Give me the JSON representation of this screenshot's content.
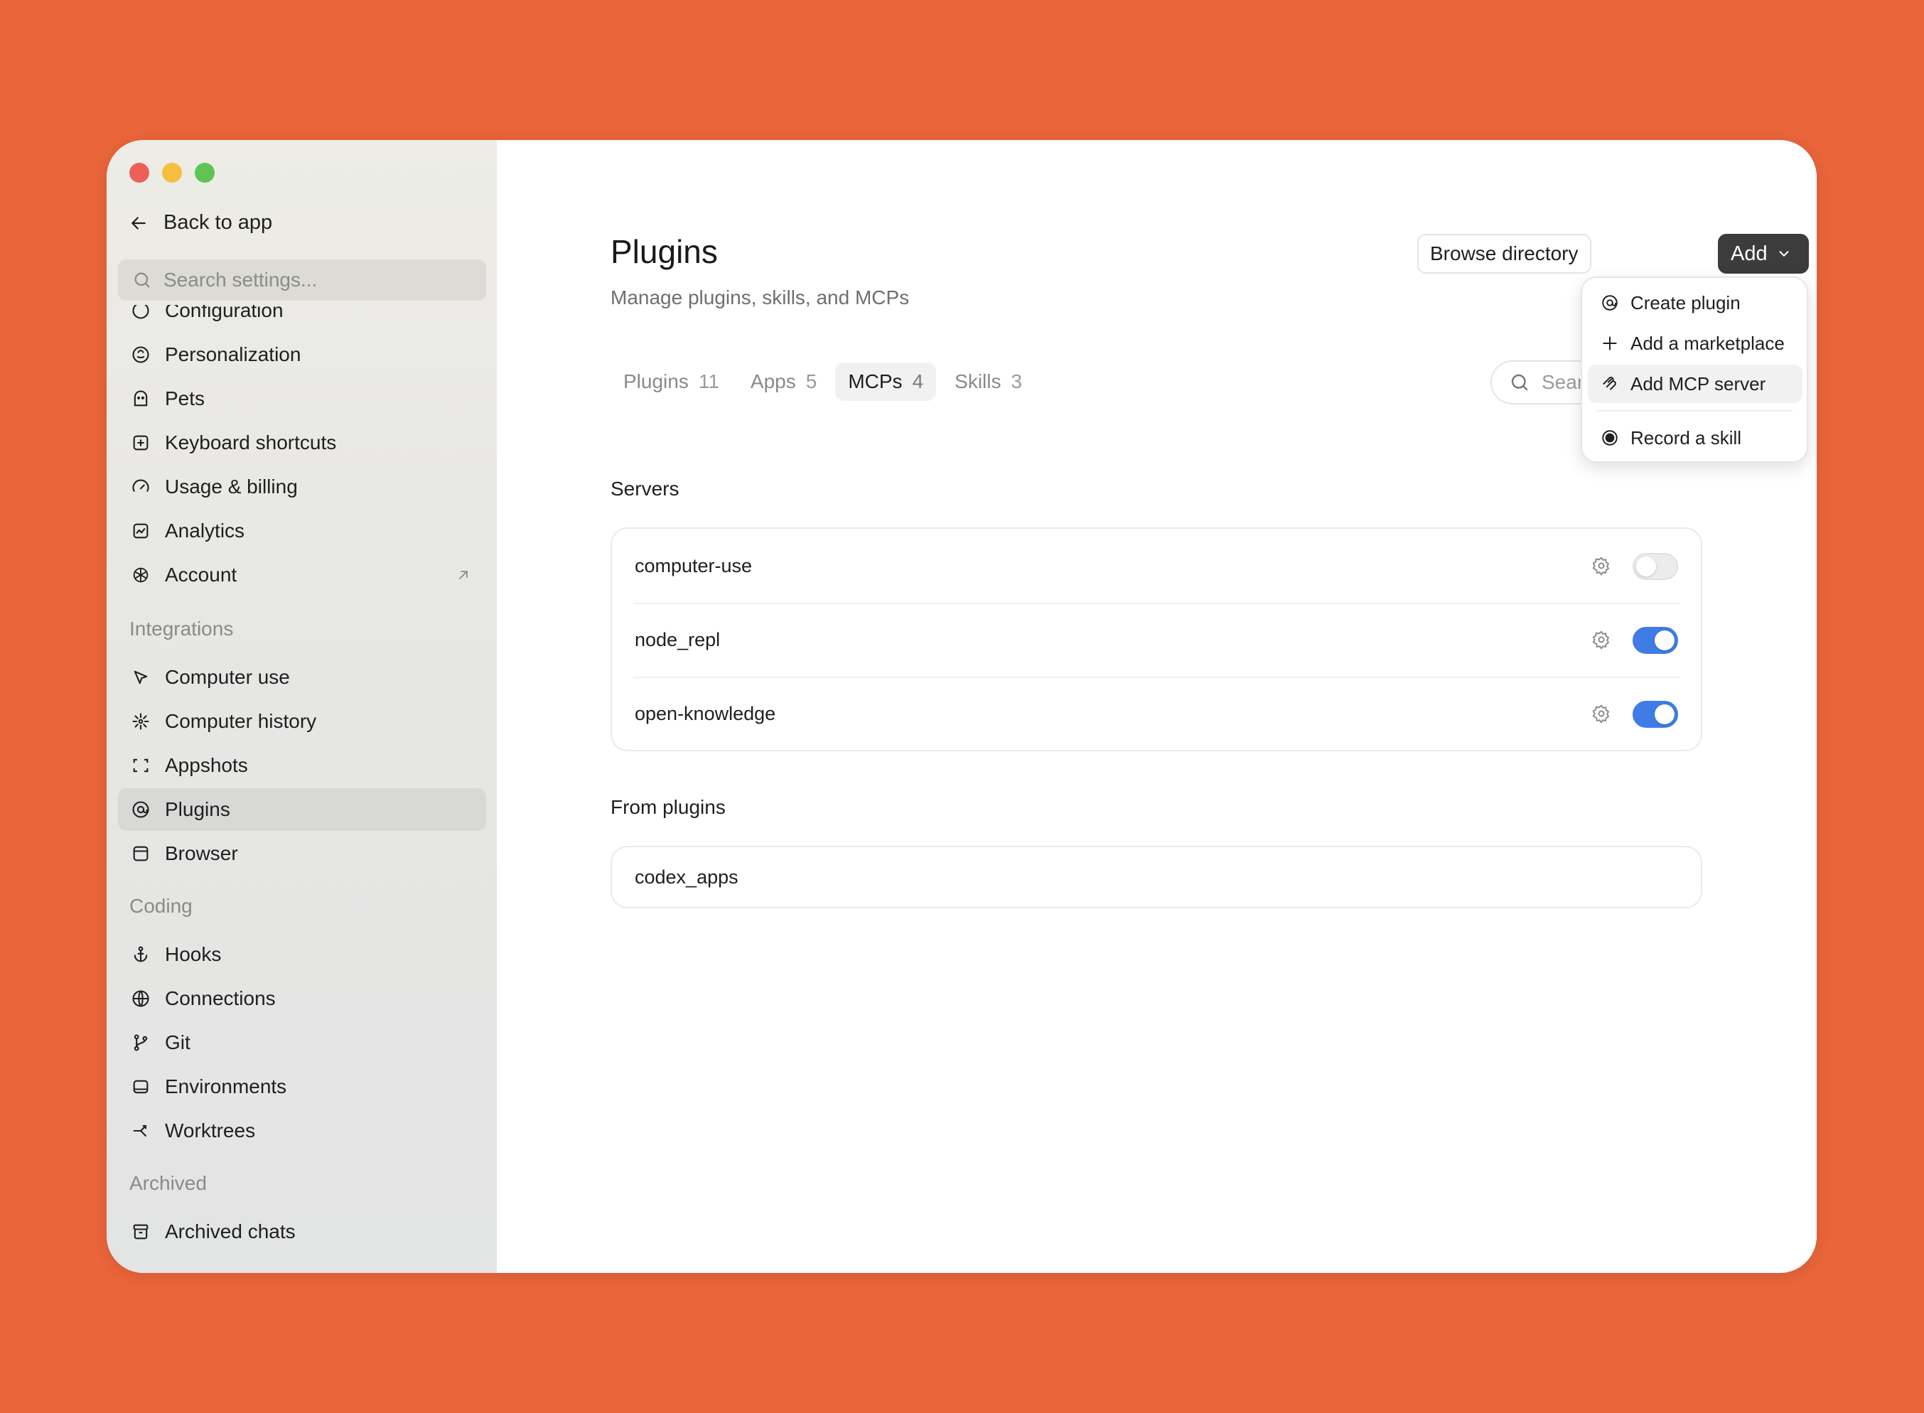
{
  "sidebar": {
    "back_label": "Back to app",
    "search_placeholder": "Search settings...",
    "partial_item": "Configuration",
    "items_top": [
      {
        "label": "Personalization",
        "icon": "palette-icon"
      },
      {
        "label": "Pets",
        "icon": "pet-icon"
      },
      {
        "label": "Keyboard shortcuts",
        "icon": "keyboard-icon"
      },
      {
        "label": "Usage & billing",
        "icon": "gauge-icon"
      },
      {
        "label": "Analytics",
        "icon": "chart-icon"
      },
      {
        "label": "Account",
        "icon": "openai-icon"
      }
    ],
    "section_integrations": "Integrations",
    "items_integrations": [
      {
        "label": "Computer use",
        "icon": "cursor-icon"
      },
      {
        "label": "Computer history",
        "icon": "history-icon"
      },
      {
        "label": "Appshots",
        "icon": "screenshot-icon"
      },
      {
        "label": "Plugins",
        "icon": "at-icon"
      },
      {
        "label": "Browser",
        "icon": "browser-icon"
      }
    ],
    "section_coding": "Coding",
    "items_coding": [
      {
        "label": "Hooks",
        "icon": "anchor-icon"
      },
      {
        "label": "Connections",
        "icon": "globe-icon"
      },
      {
        "label": "Git",
        "icon": "git-branch-icon"
      },
      {
        "label": "Environments",
        "icon": "environment-icon"
      },
      {
        "label": "Worktrees",
        "icon": "worktree-icon"
      }
    ],
    "section_archived": "Archived",
    "items_archived": [
      {
        "label": "Archived chats",
        "icon": "archive-icon"
      }
    ]
  },
  "main": {
    "title": "Plugins",
    "subtitle": "Manage plugins, skills, and MCPs",
    "browse_label": "Browse directory",
    "add_label": "Add",
    "tabs": [
      {
        "label": "Plugins",
        "count": "11"
      },
      {
        "label": "Apps",
        "count": "5"
      },
      {
        "label": "MCPs",
        "count": "4"
      },
      {
        "label": "Skills",
        "count": "3"
      }
    ],
    "search_placeholder": "Search",
    "search_visible_text": "Sear",
    "servers_title": "Servers",
    "servers": [
      {
        "name": "computer-use",
        "enabled": false
      },
      {
        "name": "node_repl",
        "enabled": true
      },
      {
        "name": "open-knowledge",
        "enabled": true
      }
    ],
    "from_plugins_title": "From plugins",
    "from_plugins": [
      {
        "name": "codex_apps"
      }
    ]
  },
  "dropdown": {
    "items": [
      {
        "label": "Create plugin",
        "icon": "at-icon"
      },
      {
        "label": "Add a marketplace",
        "icon": "plus-icon"
      },
      {
        "label": "Add MCP server",
        "icon": "mcp-icon"
      },
      {
        "label": "Record a skill",
        "icon": "record-icon"
      }
    ]
  },
  "colors": {
    "background": "#EA653A",
    "toggle_on": "#3F7CE6",
    "add_button": "#3C3C3C"
  }
}
